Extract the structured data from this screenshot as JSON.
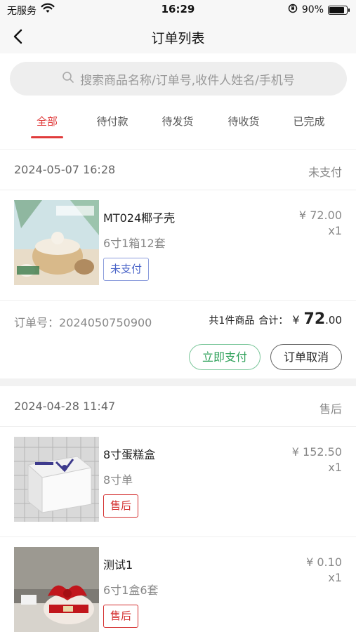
{
  "status_bar": {
    "carrier": "无服务",
    "time": "16:29",
    "battery": "90%",
    "battery_level": 0.9
  },
  "nav": {
    "title": "订单列表"
  },
  "search": {
    "placeholder": "搜索商品名称/订单号,收件人姓名/手机号"
  },
  "tabs": [
    {
      "label": "全部",
      "active": true
    },
    {
      "label": "待付款",
      "active": false
    },
    {
      "label": "待发货",
      "active": false
    },
    {
      "label": "待收货",
      "active": false
    },
    {
      "label": "已完成",
      "active": false
    }
  ],
  "orders": [
    {
      "date": "2024-05-07 16:28",
      "status": "未支付",
      "items": [
        {
          "name": "MT024椰子壳",
          "spec": "6寸1箱12套",
          "badge": "未支付",
          "price": "¥ 72.00",
          "qty": "x1"
        }
      ],
      "order_no_label": "订单号：",
      "order_no": "2024050750900",
      "count_text": "共1件商品",
      "total_label": "合计：",
      "total_currency": "¥",
      "total_int": "72",
      "total_dec": ".00",
      "pay_button": "立即支付",
      "cancel_button": "订单取消"
    },
    {
      "date": "2024-04-28 11:47",
      "status": "售后",
      "items": [
        {
          "name": "8寸蛋糕盒",
          "spec": "8寸单",
          "badge": "售后",
          "price": "¥ 152.50",
          "qty": "x1"
        },
        {
          "name": "测试1",
          "spec": "6寸1盒6套",
          "badge": "售后",
          "price": "¥ 0.10",
          "qty": "x1"
        }
      ]
    }
  ],
  "colors": {
    "accent": "#e03b3b",
    "pay_green": "#2fa15a",
    "badge_blue": "#4a64c8"
  }
}
